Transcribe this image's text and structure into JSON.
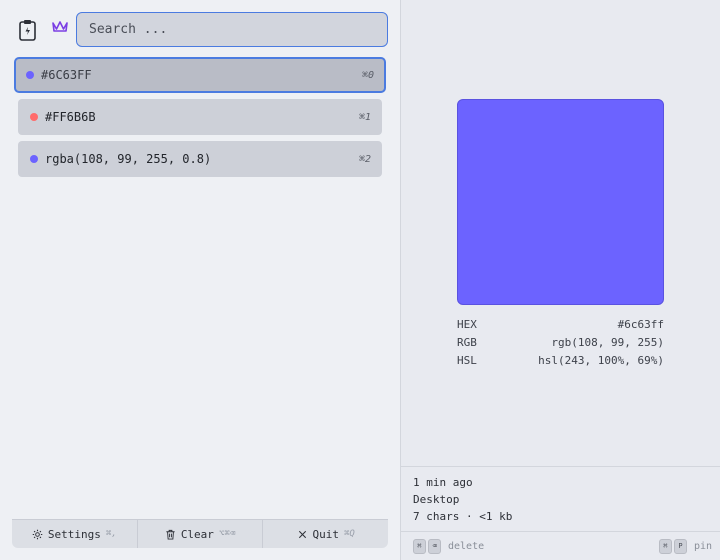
{
  "search": {
    "placeholder": "Search ...",
    "value": ""
  },
  "colors": {
    "accent": "#4b7be0",
    "crown": "#7b3fe4"
  },
  "items": [
    {
      "label": "#6C63FF",
      "shortcut": "⌘0",
      "dot": "#6c63ff",
      "selected": true
    },
    {
      "label": "#FF6B6B",
      "shortcut": "⌘1",
      "dot": "#ff6b6b",
      "selected": false
    },
    {
      "label": "rgba(108, 99, 255, 0.8)",
      "shortcut": "⌘2",
      "dot": "#6c63ff",
      "selected": false
    }
  ],
  "footer": {
    "settings_label": "Settings",
    "settings_key": "⌘,",
    "clear_label": "Clear",
    "clear_key": "⌥⌘⌫",
    "quit_label": "Quit",
    "quit_key": "⌘Q"
  },
  "preview": {
    "swatch_color": "#6c63ff",
    "rows": [
      {
        "key": "HEX",
        "value": "#6c63ff"
      },
      {
        "key": "RGB",
        "value": "rgb(108, 99, 255)"
      },
      {
        "key": "HSL",
        "value": "hsl(243, 100%, 69%)"
      }
    ],
    "time": "1 min ago",
    "source": "Desktop",
    "size": "7 chars · <1 kb"
  },
  "hints": {
    "delete_keys": [
      "⌘",
      "⌫"
    ],
    "delete_label": "delete",
    "pin_keys": [
      "⌘",
      "P"
    ],
    "pin_label": "pin"
  }
}
